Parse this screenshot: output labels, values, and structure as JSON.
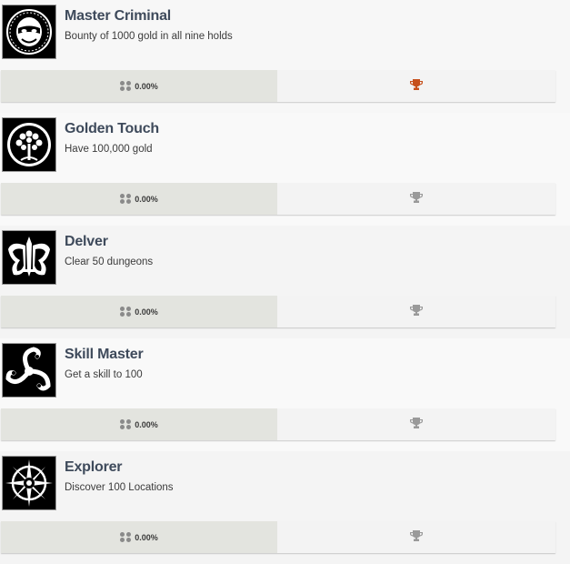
{
  "achievements": [
    {
      "title": "Master Criminal",
      "description": "Bounty of 1000 gold in all nine holds",
      "rarity": "0.00%",
      "icon": "masked-face-icon",
      "trophy_color": "#c6501c",
      "unlocked": true
    },
    {
      "title": "Golden Touch",
      "description": "Have 100,000 gold",
      "rarity": "0.00%",
      "icon": "tree-icon",
      "trophy_color": "#9a9a9a",
      "unlocked": false
    },
    {
      "title": "Delver",
      "description": "Clear 50 dungeons",
      "rarity": "0.00%",
      "icon": "winged-sword-icon",
      "trophy_color": "#9a9a9a",
      "unlocked": false
    },
    {
      "title": "Skill Master",
      "description": "Get a skill to 100",
      "rarity": "0.00%",
      "icon": "triskelion-icon",
      "trophy_color": "#9a9a9a",
      "unlocked": false
    },
    {
      "title": "Explorer",
      "description": "Discover 100 Locations",
      "rarity": "0.00%",
      "icon": "compass-star-icon",
      "trophy_color": "#9a9a9a",
      "unlocked": false
    }
  ]
}
